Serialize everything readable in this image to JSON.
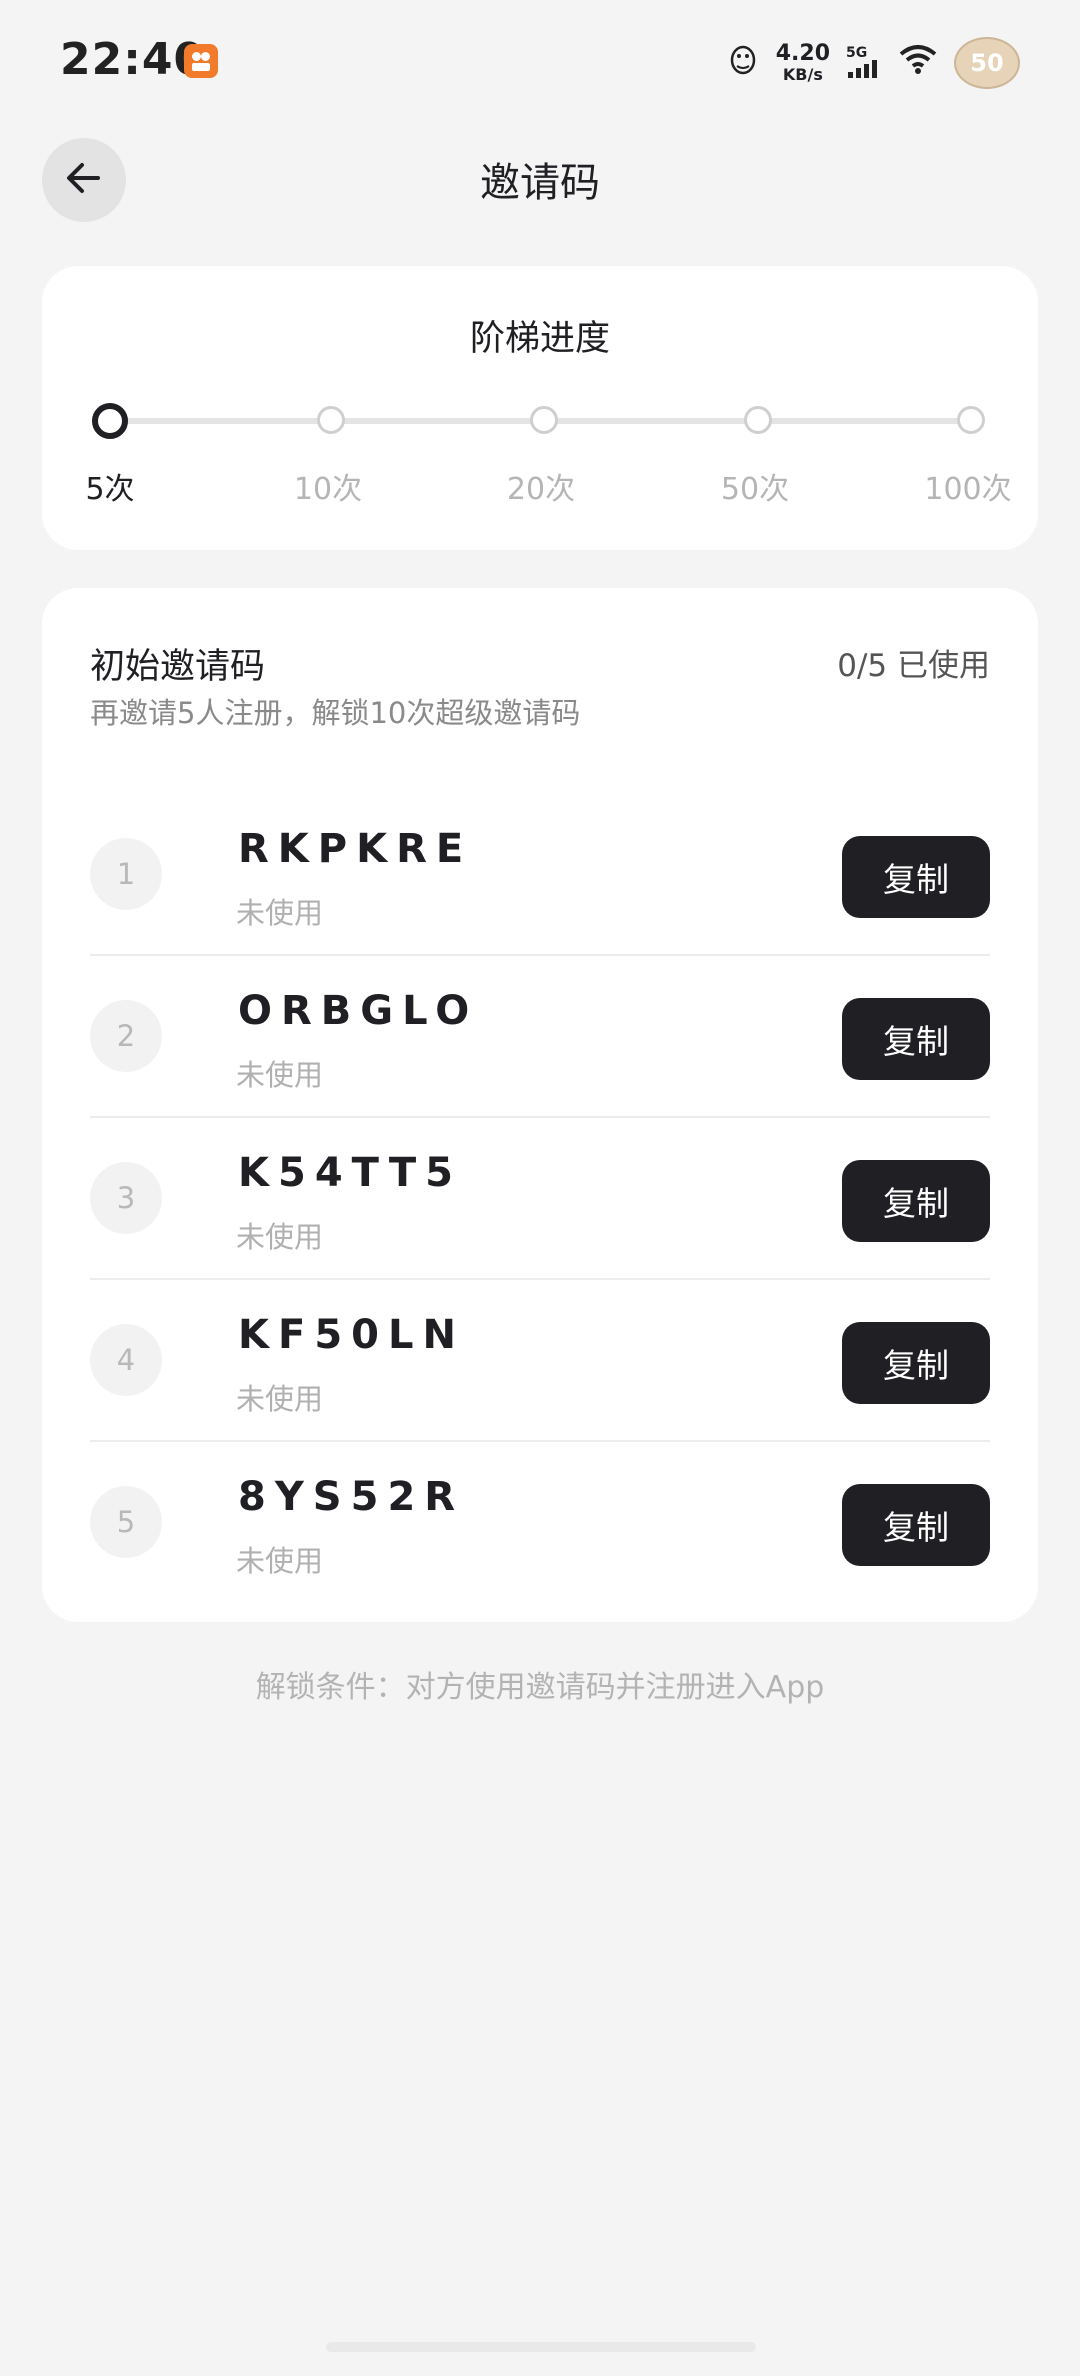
{
  "status_bar": {
    "time": "22:40",
    "net_speed_value": "4.20",
    "net_speed_unit": "KB/s",
    "network_type": "5G",
    "battery_level": "50"
  },
  "header": {
    "title": "邀请码"
  },
  "ladder": {
    "title": "阶梯进度",
    "steps": [
      {
        "label": "5次",
        "active": true
      },
      {
        "label": "10次",
        "active": false
      },
      {
        "label": "20次",
        "active": false
      },
      {
        "label": "50次",
        "active": false
      },
      {
        "label": "100次",
        "active": false
      }
    ]
  },
  "codes": {
    "title": "初始邀请码",
    "usage": "0/5 已使用",
    "subtitle": "再邀请5人注册，解锁10次超级邀请码",
    "copy_label": "复制",
    "items": [
      {
        "index": "1",
        "code": "RKPKRE",
        "status": "未使用"
      },
      {
        "index": "2",
        "code": "ORBGLO",
        "status": "未使用"
      },
      {
        "index": "3",
        "code": "K54TT5",
        "status": "未使用"
      },
      {
        "index": "4",
        "code": "KF50LN",
        "status": "未使用"
      },
      {
        "index": "5",
        "code": "8YS52R",
        "status": "未使用"
      }
    ]
  },
  "footnote": "解锁条件：对方使用邀请码并注册进入App",
  "colors": {
    "background": "#f4f4f4",
    "card": "#ffffff",
    "button": "#1f1f24",
    "muted_text": "#b3b3b3"
  }
}
